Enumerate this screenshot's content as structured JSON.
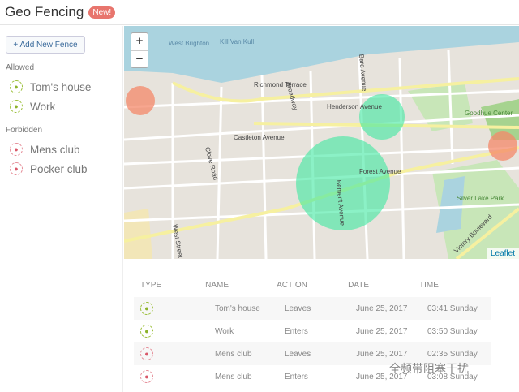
{
  "header": {
    "title": "Geo Fencing",
    "badge": "New!"
  },
  "sidebar": {
    "add_button": "+ Add New Fence",
    "allowed_label": "Allowed",
    "allowed": [
      {
        "name": "Tom's house"
      },
      {
        "name": "Work"
      }
    ],
    "forbidden_label": "Forbidden",
    "forbidden": [
      {
        "name": "Mens club"
      },
      {
        "name": "Pocker club"
      }
    ]
  },
  "map": {
    "zoom_in": "+",
    "zoom_out": "−",
    "attribution": "Leaflet",
    "streets": [
      "Richmond Terrace",
      "Henderson Avenue",
      "Castleton Avenue",
      "Forest Avenue",
      "Clove Road",
      "Broadway",
      "Bard Avenue",
      "Bement Avenue",
      "Victory Boulevard",
      "West Brighton",
      "Goodhue Center",
      "Silver Lake Park",
      "West Street",
      "Kill Van Kull"
    ],
    "colors": {
      "allowed": "#3de8a0",
      "forbidden": "#f4886a"
    }
  },
  "table": {
    "headers": [
      "TYPE",
      "NAME",
      "ACTION",
      "DATE",
      "TIME"
    ],
    "rows": [
      {
        "type": "allowed",
        "name": "Tom's house",
        "action": "Leaves",
        "date": "June 25, 2017",
        "time": "03:41 Sunday"
      },
      {
        "type": "allowed",
        "name": "Work",
        "action": "Enters",
        "date": "June 25, 2017",
        "time": "03:50 Sunday"
      },
      {
        "type": "forbidden",
        "name": "Mens club",
        "action": "Leaves",
        "date": "June 25, 2017",
        "time": "02:35 Sunday"
      },
      {
        "type": "forbidden",
        "name": "Mens club",
        "action": "Enters",
        "date": "June 25, 2017",
        "time": "03:08 Sunday"
      }
    ]
  },
  "watermark": "全频带阻塞干扰"
}
